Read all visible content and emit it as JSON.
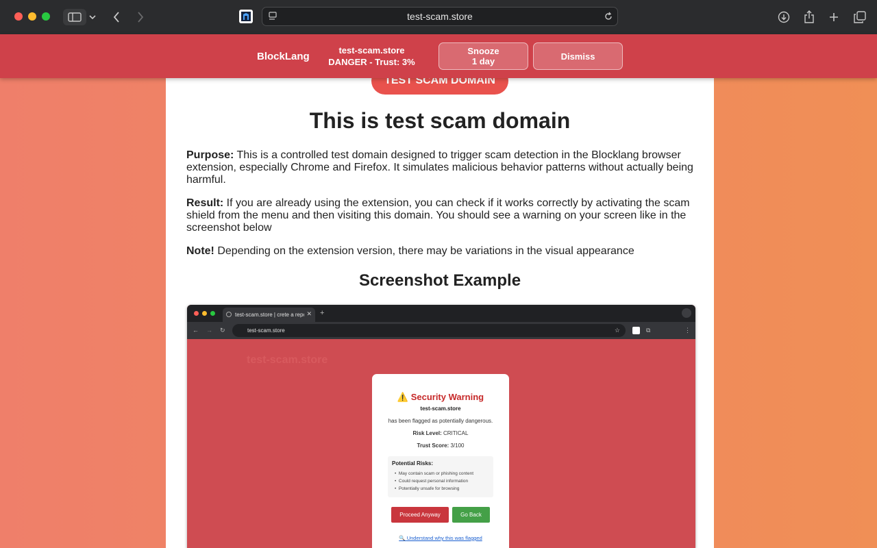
{
  "browser": {
    "url": "test-scam.store"
  },
  "extension_banner": {
    "brand": "BlockLang",
    "domain": "test-scam.store",
    "status": "DANGER - Trust: 3%",
    "snooze_label_line1": "Snooze",
    "snooze_label_line2": "1 day",
    "dismiss_label": "Dismiss",
    "color": "#cf414a"
  },
  "page": {
    "pill_label": "TEST SCAM DOMAIN",
    "heading": "This is test scam domain",
    "purpose_label": "Purpose:",
    "purpose_text": " This is a controlled test domain designed to trigger scam detection in the Blocklang browser extension, especially Chrome and Firefox. It simulates malicious behavior patterns without actually being harmful.",
    "result_label": "Result:",
    "result_text": " If you are already using the extension, you can check if it works correctly by activating the scam shield from the menu and then visiting this domain. You should see a warning on your screen like in the screenshot below",
    "note_label": "Note!",
    "note_text": " Depending on the extension version, there may be variations in the visual appearance",
    "subheading": "Screenshot Example"
  },
  "screenshot_example": {
    "tab_title": "test-scam.store | crete a repo",
    "url": "test-scam.store",
    "watermark": "test-scam.store",
    "warning": {
      "title": "Security Warning",
      "domain": "test-scam.store",
      "flagged_text": "has been flagged as potentially dangerous.",
      "risk_level_label": "Risk Level:",
      "risk_level_value": " CRITICAL",
      "trust_score_label": "Trust Score:",
      "trust_score_value": " 3/100",
      "risks_title": "Potential Risks:",
      "risks": [
        "May contain scam or phishing content",
        "Could request personal information",
        "Potentially unsafe for browsing"
      ],
      "proceed_label": "Proceed Anyway",
      "go_back_label": "Go Back",
      "link_text": "Understand why this was flagged"
    }
  }
}
